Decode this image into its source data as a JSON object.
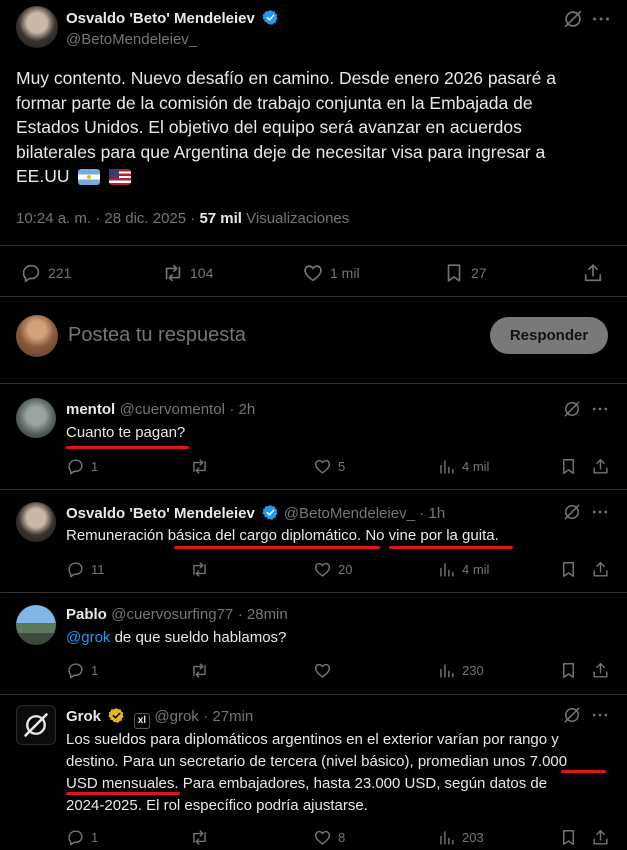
{
  "post": {
    "author_name": "Osvaldo 'Beto' Mendeleiev",
    "author_handle": "@BetoMendeleiev_",
    "text_l1": "Muy contento. Nuevo desafío en camino. Desde enero 2026 pasaré a",
    "text_l2": "formar parte de la comisión de trabajo conjunta en la Embajada de",
    "text_l3": "Estados Unidos. El objetivo del equipo será avanzar en acuerdos",
    "text_l4": "bilaterales para que Argentina deje de necesitar visa para ingresar a",
    "text_l5": "EE.UU",
    "meta_time": "10:24 a. m. · 28 dic. 2025 · ",
    "meta_views_count": "57 mil",
    "meta_views_label": " Visualizaciones",
    "stats": {
      "replies": "221",
      "reposts": "104",
      "likes": "1 mil",
      "bookmarks": "27"
    }
  },
  "composer": {
    "placeholder": "Postea tu respuesta",
    "button": "Responder"
  },
  "replies": [
    {
      "name": "mentol",
      "handle": "@cuervomentol",
      "time": "· 2h",
      "text": "Cuanto te pagan?",
      "stats": {
        "replies": "1",
        "reposts": "",
        "likes": "5",
        "views": "4 mil"
      }
    },
    {
      "name": "Osvaldo 'Beto' Mendeleiev",
      "handle": "@BetoMendeleiev_",
      "time": "· 1h",
      "text_a": "Remuneración ",
      "text_b": "básica del cargo diplomático.",
      "text_c": " ",
      "text_d": "No vine por la guita",
      "text_e": ".",
      "stats": {
        "replies": "11",
        "reposts": "",
        "likes": "20",
        "views": "4 mil"
      }
    },
    {
      "name": "Pablo",
      "handle": "@cuervosurfing77",
      "time": "· 28min",
      "mention": "@grok",
      "text": " de que sueldo hablamos?",
      "stats": {
        "replies": "1",
        "reposts": "",
        "likes": "",
        "views": "230"
      }
    },
    {
      "name": "Grok",
      "handle": "@grok",
      "time": "· 27min",
      "badge": "xl",
      "text_l1": "Los sueldos para diplomáticos argentinos en el exterior varían por rango y",
      "text_l2": "destino. Para un secretario de tercera (nivel básico), promedian unos 7.000",
      "text_l3": "USD mensuales. Para embajadores, hasta 23.000 USD, según datos de",
      "text_l4": "2024-2025. El rol específico podría ajustarse.",
      "stats": {
        "replies": "1",
        "reposts": "",
        "likes": "8",
        "views": "203"
      }
    }
  ]
}
